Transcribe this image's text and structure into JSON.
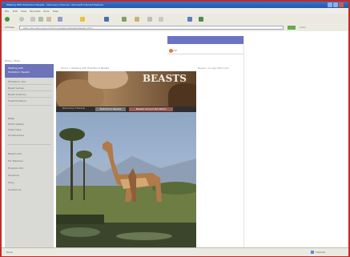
{
  "window": {
    "title": "Walking With Prehistoric Beasts - Discovery Channel - Microsoft Internet Explorer"
  },
  "menu": [
    "File",
    "Edit",
    "View",
    "Favorites",
    "Tools",
    "Help"
  ],
  "toolbar": {
    "icons": [
      "back-icon",
      "forward-icon",
      "stop-icon",
      "refresh-icon",
      "home-icon",
      "search-icon",
      "favorites-icon",
      "media-icon",
      "history-icon",
      "mail-icon",
      "print-icon",
      "edit-icon",
      "discuss-icon",
      "messenger-icon"
    ],
    "search_label": "Search",
    "favorites_label": "Favorites",
    "media_label": "Media"
  },
  "address": {
    "label": "Address",
    "url": "http://dsc.discovery.com/convergence/beasts/beasts.html",
    "go": "Go",
    "links": "Links"
  },
  "page": {
    "search_label": "Search",
    "breadcrumb_left": "Home | Help",
    "crumbs": "Home > Walking with Prehistoric Beasts",
    "crumbs_right": "Beasts: Ice Age Mammals",
    "banner_title": "BEASTS",
    "banner_sub": "Discovery Channel",
    "tab1": "Prehistoric Beasts",
    "tab2": "Beasts Around the World",
    "sidebar": {
      "head_line1": "Walking with",
      "head_line2": "Prehistoric Beasts",
      "items": [
        "Prehistoric Zoo",
        "Beast Games",
        "Beast Anatomy",
        "Fossil Evidence",
        "Tools",
        "Photo Gallery",
        "Video Clips",
        "Screensavers",
        "Beast Links",
        "For Teachers",
        "Program Info",
        "Schedule",
        "Shop",
        "Contact Us"
      ]
    }
  },
  "status": {
    "text": "Done",
    "zone": "Internet"
  },
  "colors": {
    "accent": "#6c73c4",
    "title_bar": "#2d62b8",
    "frame": "#c42a26"
  }
}
